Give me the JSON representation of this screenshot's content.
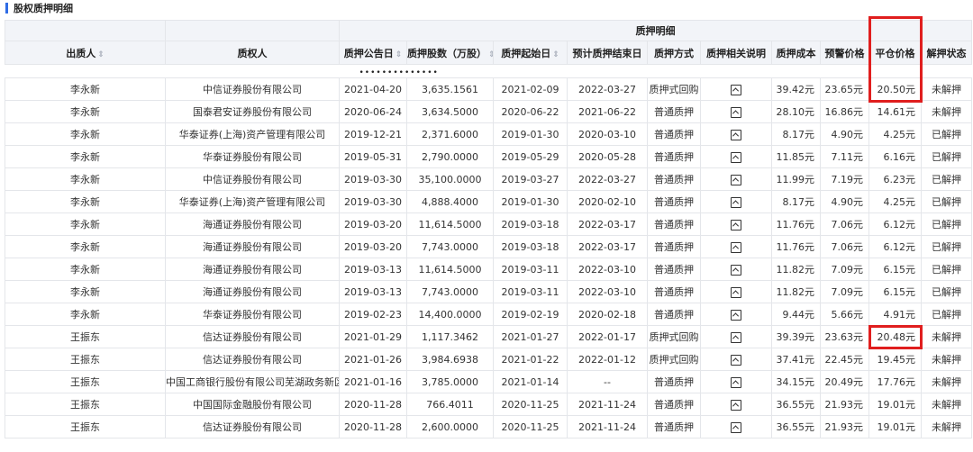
{
  "section": {
    "title": "股权质押明细"
  },
  "header": {
    "group_label": "质押明细",
    "columns": {
      "pledgor": "出质人",
      "pledgee": "质权人",
      "announce_date": "质押公告日",
      "shares": "质押股数（万股）",
      "start_date": "质押起始日",
      "end_date": "预计质押结束日",
      "method": "质押方式",
      "note": "质押相关说明",
      "cost": "质押成本",
      "warning_price": "预警价格",
      "liquidation_price": "平仓价格",
      "release_status": "解押状态"
    },
    "loading_dots": "••••••••••••••"
  },
  "rows": [
    {
      "pledgor": "李永新",
      "pledgee": "中信证券股份有限公司",
      "announce_date": "2021-04-20",
      "shares": "3,635.1561",
      "start_date": "2021-02-09",
      "end_date": "2022-03-27",
      "method": "质押式回购",
      "cost": "39.42元",
      "warning_price": "23.65元",
      "liquidation_price": "20.50元",
      "release_status": "未解押"
    },
    {
      "pledgor": "李永新",
      "pledgee": "国泰君安证券股份有限公司",
      "announce_date": "2020-06-24",
      "shares": "3,634.5000",
      "start_date": "2020-06-22",
      "end_date": "2021-06-22",
      "method": "普通质押",
      "cost": "28.10元",
      "warning_price": "16.86元",
      "liquidation_price": "14.61元",
      "release_status": "未解押"
    },
    {
      "pledgor": "李永新",
      "pledgee": "华泰证券(上海)资产管理有限公司",
      "announce_date": "2019-12-21",
      "shares": "2,371.6000",
      "start_date": "2019-01-30",
      "end_date": "2020-03-10",
      "method": "普通质押",
      "cost": "8.17元",
      "warning_price": "4.90元",
      "liquidation_price": "4.25元",
      "release_status": "已解押"
    },
    {
      "pledgor": "李永新",
      "pledgee": "华泰证券股份有限公司",
      "announce_date": "2019-05-31",
      "shares": "2,790.0000",
      "start_date": "2019-05-29",
      "end_date": "2020-05-28",
      "method": "普通质押",
      "cost": "11.85元",
      "warning_price": "7.11元",
      "liquidation_price": "6.16元",
      "release_status": "已解押"
    },
    {
      "pledgor": "李永新",
      "pledgee": "中信证券股份有限公司",
      "announce_date": "2019-03-30",
      "shares": "35,100.0000",
      "start_date": "2019-03-27",
      "end_date": "2022-03-27",
      "method": "普通质押",
      "cost": "11.99元",
      "warning_price": "7.19元",
      "liquidation_price": "6.23元",
      "release_status": "已解押"
    },
    {
      "pledgor": "李永新",
      "pledgee": "华泰证券(上海)资产管理有限公司",
      "announce_date": "2019-03-30",
      "shares": "4,888.4000",
      "start_date": "2019-01-30",
      "end_date": "2020-02-10",
      "method": "普通质押",
      "cost": "8.17元",
      "warning_price": "4.90元",
      "liquidation_price": "4.25元",
      "release_status": "已解押"
    },
    {
      "pledgor": "李永新",
      "pledgee": "海通证券股份有限公司",
      "announce_date": "2019-03-20",
      "shares": "11,614.5000",
      "start_date": "2019-03-18",
      "end_date": "2022-03-17",
      "method": "普通质押",
      "cost": "11.76元",
      "warning_price": "7.06元",
      "liquidation_price": "6.12元",
      "release_status": "已解押"
    },
    {
      "pledgor": "李永新",
      "pledgee": "海通证券股份有限公司",
      "announce_date": "2019-03-20",
      "shares": "7,743.0000",
      "start_date": "2019-03-18",
      "end_date": "2022-03-17",
      "method": "普通质押",
      "cost": "11.76元",
      "warning_price": "7.06元",
      "liquidation_price": "6.12元",
      "release_status": "已解押"
    },
    {
      "pledgor": "李永新",
      "pledgee": "海通证券股份有限公司",
      "announce_date": "2019-03-13",
      "shares": "11,614.5000",
      "start_date": "2019-03-11",
      "end_date": "2022-03-10",
      "method": "普通质押",
      "cost": "11.82元",
      "warning_price": "7.09元",
      "liquidation_price": "6.15元",
      "release_status": "已解押"
    },
    {
      "pledgor": "李永新",
      "pledgee": "海通证券股份有限公司",
      "announce_date": "2019-03-13",
      "shares": "7,743.0000",
      "start_date": "2019-03-11",
      "end_date": "2022-03-10",
      "method": "普通质押",
      "cost": "11.82元",
      "warning_price": "7.09元",
      "liquidation_price": "6.15元",
      "release_status": "已解押"
    },
    {
      "pledgor": "李永新",
      "pledgee": "华泰证券股份有限公司",
      "announce_date": "2019-02-23",
      "shares": "14,400.0000",
      "start_date": "2019-02-19",
      "end_date": "2020-02-18",
      "method": "普通质押",
      "cost": "9.44元",
      "warning_price": "5.66元",
      "liquidation_price": "4.91元",
      "release_status": "已解押"
    },
    {
      "pledgor": "王振东",
      "pledgee": "信达证券股份有限公司",
      "announce_date": "2021-01-29",
      "shares": "1,117.3462",
      "start_date": "2021-01-27",
      "end_date": "2022-01-17",
      "method": "质押式回购",
      "cost": "39.39元",
      "warning_price": "23.63元",
      "liquidation_price": "20.48元",
      "release_status": "未解押"
    },
    {
      "pledgor": "王振东",
      "pledgee": "信达证券股份有限公司",
      "announce_date": "2021-01-26",
      "shares": "3,984.6938",
      "start_date": "2021-01-22",
      "end_date": "2022-01-12",
      "method": "质押式回购",
      "cost": "37.41元",
      "warning_price": "22.45元",
      "liquidation_price": "19.45元",
      "release_status": "未解押"
    },
    {
      "pledgor": "王振东",
      "pledgee": "中国工商银行股份有限公司芜湖政务新区支行",
      "announce_date": "2021-01-16",
      "shares": "3,785.0000",
      "start_date": "2021-01-14",
      "end_date": "--",
      "method": "普通质押",
      "cost": "34.15元",
      "warning_price": "20.49元",
      "liquidation_price": "17.76元",
      "release_status": "未解押"
    },
    {
      "pledgor": "王振东",
      "pledgee": "中国国际金融股份有限公司",
      "announce_date": "2020-11-28",
      "shares": "766.4011",
      "start_date": "2020-11-25",
      "end_date": "2021-11-24",
      "method": "普通质押",
      "cost": "36.55元",
      "warning_price": "21.93元",
      "liquidation_price": "19.01元",
      "release_status": "未解押"
    },
    {
      "pledgor": "王振东",
      "pledgee": "信达证券股份有限公司",
      "announce_date": "2020-11-28",
      "shares": "2,600.0000",
      "start_date": "2020-11-25",
      "end_date": "2021-11-24",
      "method": "普通质押",
      "cost": "36.55元",
      "warning_price": "21.93元",
      "liquidation_price": "19.01元",
      "release_status": "未解押"
    }
  ],
  "highlights": {
    "color": "#e01e1e"
  }
}
